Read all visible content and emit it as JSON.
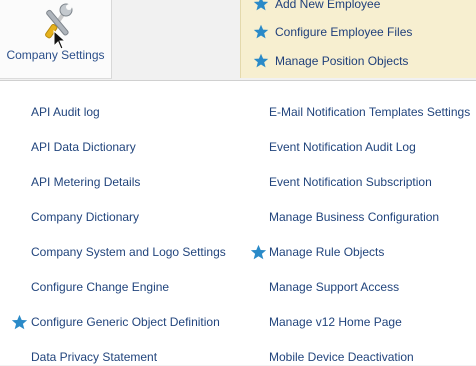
{
  "tile": {
    "label": "Company Settings",
    "icon": "tools-icon"
  },
  "favorites": [
    {
      "label": "Add New Employee",
      "starred": true
    },
    {
      "label": "Configure Employee Files",
      "starred": true
    },
    {
      "label": "Manage Position Objects",
      "starred": true
    }
  ],
  "menu": {
    "left": [
      {
        "label": "API Audit log",
        "starred": false
      },
      {
        "label": "API Data Dictionary",
        "starred": false
      },
      {
        "label": "API Metering Details",
        "starred": false
      },
      {
        "label": "Company Dictionary",
        "starred": false
      },
      {
        "label": "Company System and Logo Settings",
        "starred": false
      },
      {
        "label": "Configure Change Engine",
        "starred": false
      },
      {
        "label": "Configure Generic Object Definition",
        "starred": true
      },
      {
        "label": "Data Privacy Statement",
        "starred": false
      }
    ],
    "right": [
      {
        "label": "E-Mail Notification Templates Settings",
        "starred": false
      },
      {
        "label": "Event Notification Audit Log",
        "starred": false
      },
      {
        "label": "Event Notification Subscription",
        "starred": false
      },
      {
        "label": "Manage Business Configuration",
        "starred": false
      },
      {
        "label": "Manage Rule Objects",
        "starred": true
      },
      {
        "label": "Manage Support Access",
        "starred": false
      },
      {
        "label": "Manage v12 Home Page",
        "starred": false
      },
      {
        "label": "Mobile Device Deactivation",
        "starred": false
      }
    ]
  },
  "colors": {
    "link": "#22457d",
    "star": "#2a8ac8",
    "favorites_bg": "#f7efd0"
  }
}
